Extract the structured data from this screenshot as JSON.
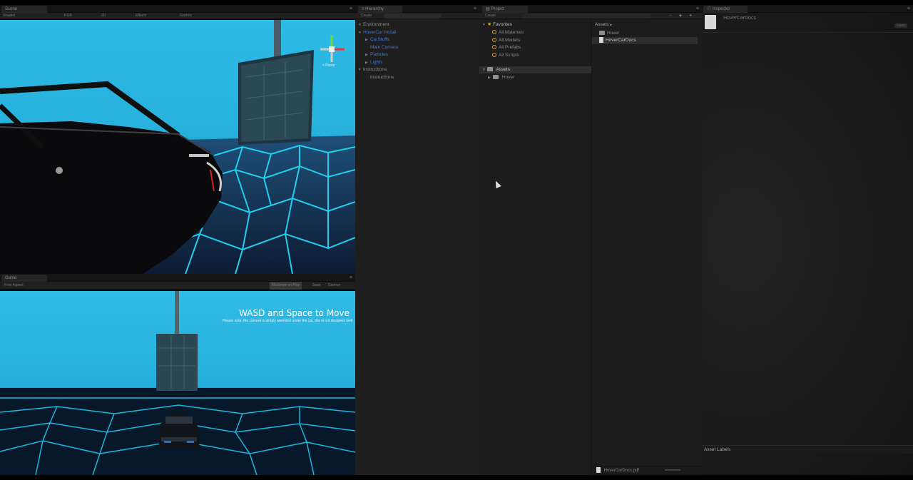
{
  "scene": {
    "tab": "Scene",
    "toolbar": [
      "Shaded",
      "RGB",
      "2D",
      "Effects",
      "Gizmos"
    ],
    "persp_label": "< Persp"
  },
  "game": {
    "tab": "Game",
    "aspect": "Free Aspect",
    "buttons": [
      "Maximize on Play",
      "Stats",
      "Gizmos"
    ],
    "message": "WASD and Space to Move",
    "note": "Please note, the camera is simply parented under the car, this is not designed well"
  },
  "hierarchy": {
    "tab": "Hierarchy",
    "create": "Create",
    "items": [
      {
        "label": "Environment",
        "style": "grey",
        "indent": 0,
        "fold": "▼"
      },
      {
        "label": "HoverCar Install",
        "style": "blue",
        "indent": 0,
        "fold": "▼"
      },
      {
        "label": "CarStuffs",
        "style": "blue",
        "indent": 1,
        "fold": "▶"
      },
      {
        "label": "Main Camera",
        "style": "blue",
        "indent": 1,
        "fold": ""
      },
      {
        "label": "Particles",
        "style": "blue",
        "indent": 1,
        "fold": "▶"
      },
      {
        "label": "Lights",
        "style": "blue",
        "indent": 1,
        "fold": "▶"
      },
      {
        "label": "Instructions",
        "style": "grey",
        "indent": 0,
        "fold": "▼"
      },
      {
        "label": "Instructions",
        "style": "grey",
        "indent": 1,
        "fold": ""
      }
    ]
  },
  "project": {
    "tab": "Project",
    "create": "Create",
    "favorites_label": "Favorites",
    "favorites": [
      "All Materials",
      "All Models",
      "All Prefabs",
      "All Scripts"
    ],
    "assets_label": "Assets",
    "asset_tree": [
      "Hover"
    ],
    "breadcrumb": "Assets",
    "files": [
      {
        "label": "Hover",
        "icon": "folder-icon"
      },
      {
        "label": "HoverCarDocs",
        "icon": "document-icon"
      }
    ],
    "status_file": "HoverCarDocs.pdf"
  },
  "inspector": {
    "tab": "Inspector",
    "asset_name": "HoverCarDocs",
    "open_button": "Open",
    "asset_labels": "Asset Labels"
  }
}
